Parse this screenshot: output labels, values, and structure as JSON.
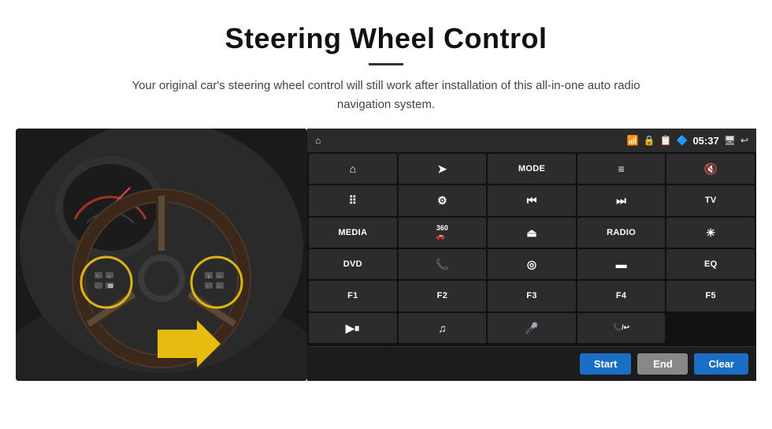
{
  "header": {
    "title": "Steering Wheel Control",
    "subtitle": "Your original car's steering wheel control will still work after installation of this all-in-one auto radio navigation system."
  },
  "status_bar": {
    "time": "05:37",
    "icons": [
      "wifi",
      "lock",
      "sim",
      "bluetooth",
      "screen",
      "back"
    ]
  },
  "buttons": [
    {
      "id": "home",
      "icon": "⌂",
      "label": "",
      "row": 1,
      "col": 1
    },
    {
      "id": "navigate",
      "icon": "➤",
      "label": "",
      "row": 1,
      "col": 2
    },
    {
      "id": "mode",
      "icon": "",
      "label": "MODE",
      "row": 1,
      "col": 3
    },
    {
      "id": "list",
      "icon": "≡",
      "label": "",
      "row": 1,
      "col": 4
    },
    {
      "id": "mute",
      "icon": "🔇",
      "label": "",
      "row": 1,
      "col": 5
    },
    {
      "id": "apps",
      "icon": "⠿",
      "label": "",
      "row": 1,
      "col": 6
    },
    {
      "id": "settings",
      "icon": "⚙",
      "label": "",
      "row": 2,
      "col": 1
    },
    {
      "id": "prev",
      "icon": "⏮",
      "label": "",
      "row": 2,
      "col": 2
    },
    {
      "id": "next",
      "icon": "⏭",
      "label": "",
      "row": 2,
      "col": 3
    },
    {
      "id": "tv",
      "icon": "",
      "label": "TV",
      "row": 2,
      "col": 4
    },
    {
      "id": "media",
      "icon": "",
      "label": "MEDIA",
      "row": 2,
      "col": 5
    },
    {
      "id": "360",
      "icon": "",
      "label": "360",
      "row": 3,
      "col": 1
    },
    {
      "id": "eject",
      "icon": "⏏",
      "label": "",
      "row": 3,
      "col": 2
    },
    {
      "id": "radio",
      "icon": "",
      "label": "RADIO",
      "row": 3,
      "col": 3
    },
    {
      "id": "brightness",
      "icon": "☀",
      "label": "",
      "row": 3,
      "col": 4
    },
    {
      "id": "dvd",
      "icon": "",
      "label": "DVD",
      "row": 3,
      "col": 5
    },
    {
      "id": "phone",
      "icon": "📞",
      "label": "",
      "row": 4,
      "col": 1
    },
    {
      "id": "internet",
      "icon": "◎",
      "label": "",
      "row": 4,
      "col": 2
    },
    {
      "id": "screen2",
      "icon": "▬",
      "label": "",
      "row": 4,
      "col": 3
    },
    {
      "id": "eq",
      "icon": "",
      "label": "EQ",
      "row": 4,
      "col": 4
    },
    {
      "id": "f1",
      "icon": "",
      "label": "F1",
      "row": 4,
      "col": 5
    },
    {
      "id": "f2",
      "icon": "",
      "label": "F2",
      "row": 5,
      "col": 1
    },
    {
      "id": "f3",
      "icon": "",
      "label": "F3",
      "row": 5,
      "col": 2
    },
    {
      "id": "f4",
      "icon": "",
      "label": "F4",
      "row": 5,
      "col": 3
    },
    {
      "id": "f5",
      "icon": "",
      "label": "F5",
      "row": 5,
      "col": 4
    },
    {
      "id": "playpause",
      "icon": "▶⏸",
      "label": "",
      "row": 5,
      "col": 5
    },
    {
      "id": "music",
      "icon": "♫",
      "label": "",
      "row": 6,
      "col": 1
    },
    {
      "id": "mic",
      "icon": "🎤",
      "label": "",
      "row": 6,
      "col": 2
    },
    {
      "id": "call",
      "icon": "📞/↩",
      "label": "",
      "row": 6,
      "col": 3
    }
  ],
  "bottom_buttons": {
    "start_label": "Start",
    "end_label": "End",
    "clear_label": "Clear"
  },
  "colors": {
    "panel_bg": "#1c1c1e",
    "btn_bg": "#2c2c2e",
    "status_bg": "#2a2a2a",
    "accent_blue": "#1a6fc4",
    "btn_gray": "#888888"
  }
}
